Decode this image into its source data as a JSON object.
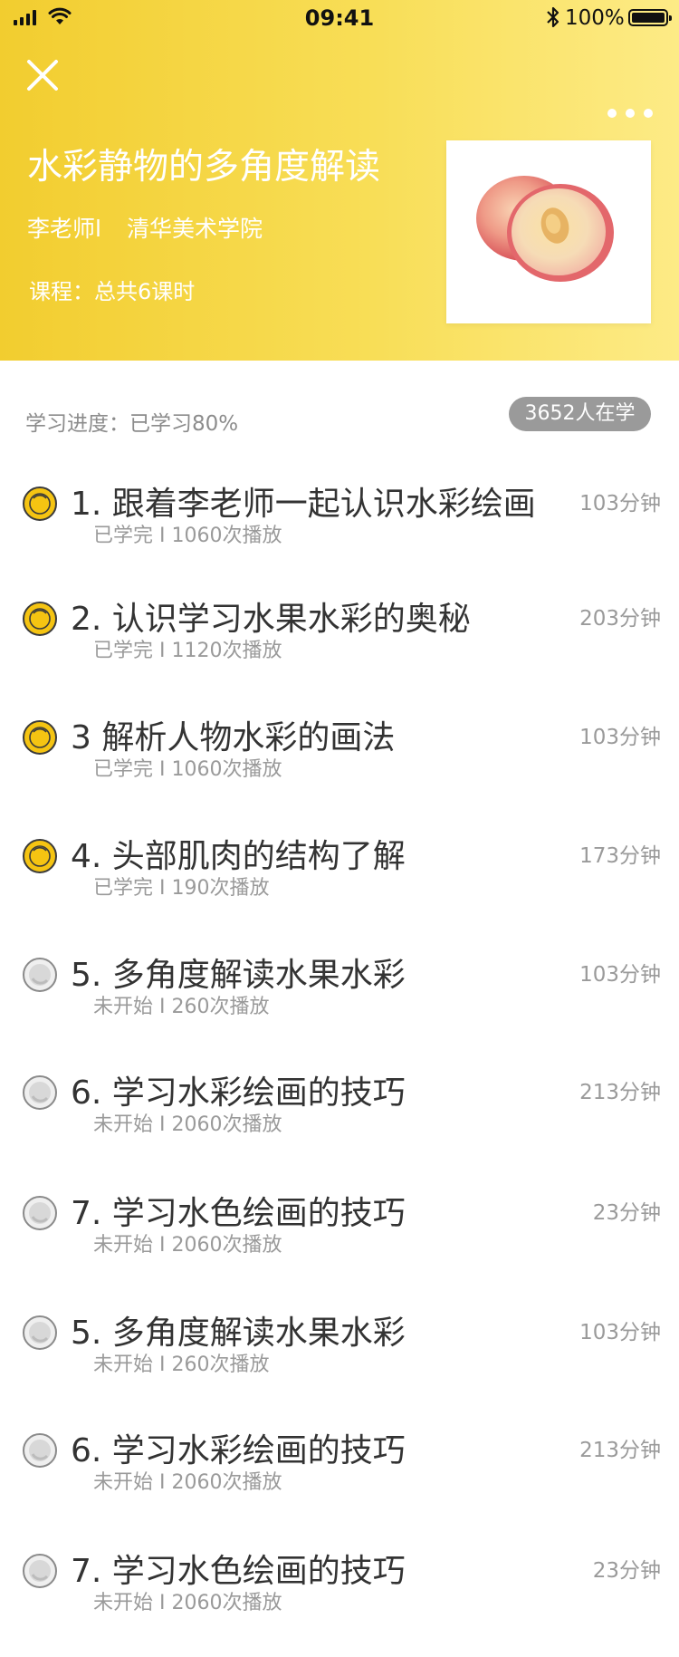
{
  "status_bar": {
    "time": "09:41",
    "battery": "100%"
  },
  "header": {
    "title": "水彩静物的多角度解读",
    "teacher": "李老师l",
    "school": "清华美术学院",
    "course_info": "课程：总共6课时",
    "close_icon": "close-icon",
    "more_icon": "more-icon"
  },
  "progress": {
    "label": "学习进度：已学习80%",
    "learners": "3652人在学"
  },
  "colors": {
    "accent": "#f4cd2f",
    "badge": "#9a9a9a",
    "text": "#333333",
    "muted": "#9a9a9a"
  },
  "lessons": [
    {
      "title": "1. 跟着李老师一起认识水彩绘画",
      "status": "已学完 I 1060次播放",
      "duration": "103分钟",
      "state": "done"
    },
    {
      "title": "2. 认识学习水果水彩的奥秘",
      "status": "已学完 I 1120次播放",
      "duration": "203分钟",
      "state": "done"
    },
    {
      "title": "3 解析人物水彩的画法",
      "status": "已学完 I 1060次播放",
      "duration": "103分钟",
      "state": "done"
    },
    {
      "title": "4. 头部肌肉的结构了解",
      "status": "已学完 I 190次播放",
      "duration": "173分钟",
      "state": "done"
    },
    {
      "title": "5. 多角度解读水果水彩",
      "status": "未开始 I 260次播放",
      "duration": "103分钟",
      "state": "todo"
    },
    {
      "title": "6. 学习水彩绘画的技巧",
      "status": "未开始 I 2060次播放",
      "duration": "213分钟",
      "state": "todo"
    },
    {
      "title": "7. 学习水色绘画的技巧",
      "status": "未开始 I 2060次播放",
      "duration": "23分钟",
      "state": "todo"
    },
    {
      "title": "5. 多角度解读水果水彩",
      "status": "未开始 I 260次播放",
      "duration": "103分钟",
      "state": "todo"
    },
    {
      "title": "6. 学习水彩绘画的技巧",
      "status": "未开始 I 2060次播放",
      "duration": "213分钟",
      "state": "todo"
    },
    {
      "title": "7. 学习水色绘画的技巧",
      "status": "未开始 I 2060次播放",
      "duration": "23分钟",
      "state": "todo"
    }
  ]
}
